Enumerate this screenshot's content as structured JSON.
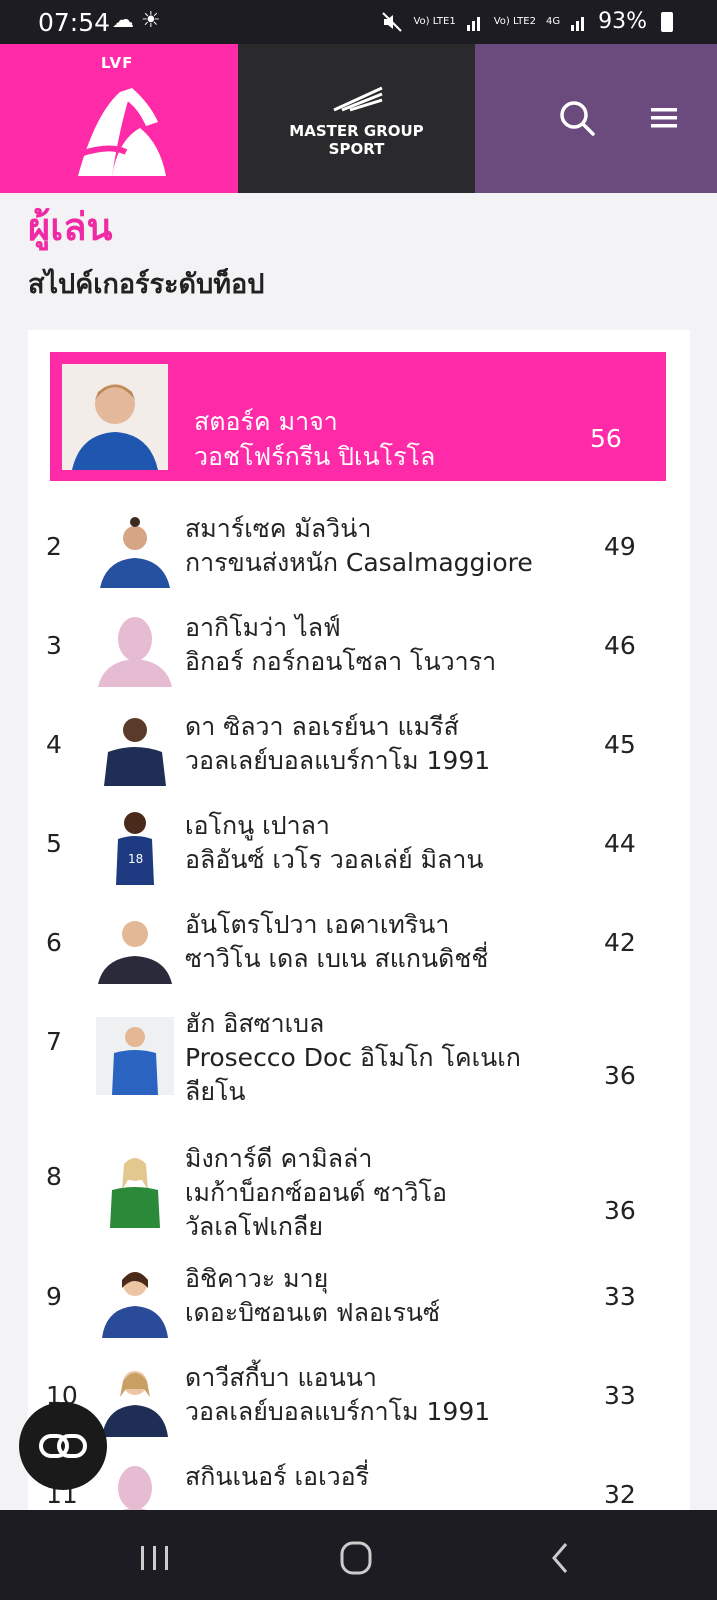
{
  "status_bar": {
    "time": "07:54",
    "weather": "☁ ☀",
    "lte1": "Vo) LTE1",
    "lte2": "Vo) LTE2",
    "network": "4G",
    "battery": "93%"
  },
  "header": {
    "logo_text": "LVF",
    "sponsor_line1": "MASTER GROUP",
    "sponsor_line2": "SPORT"
  },
  "page": {
    "title": "ผู้เล่น",
    "subtitle": "สไปค์เกอร์ระดับท็อป"
  },
  "leader": {
    "name": "สตอร์ค มาจา",
    "team": "วอชโฟร์กรีน ปิเนโรโล",
    "value": "56"
  },
  "players": [
    {
      "rank": "2",
      "name": "สมาร์เซค มัลวิน่า",
      "team": "การขนส่งหนัก Casalmaggiore",
      "value": "49"
    },
    {
      "rank": "3",
      "name": "อากิโมว่า ไลฟ์",
      "team": "อิกอร์ กอร์กอนโซลา โนวารา",
      "value": "46"
    },
    {
      "rank": "4",
      "name": "ดา ซิลวา ลอเรย์นา แมรีส์",
      "team": "วอลเลย์บอลแบร์กาโม 1991",
      "value": "45"
    },
    {
      "rank": "5",
      "name": "เอโกนู เปาลา",
      "team": "อลิอันซ์ เวโร วอลเล่ย์ มิลาน",
      "value": "44"
    },
    {
      "rank": "6",
      "name": "อันโตรโปวา เอคาเทรินา",
      "team": "ซาวิโน เดล เบเน สแกนดิชชี่",
      "value": "42"
    },
    {
      "rank": "7",
      "name": "ฮัก อิสซาเบล",
      "team": "Prosecco Doc อิโมโก โคเนเกลียโน",
      "value": "36"
    },
    {
      "rank": "8",
      "name": "มิงการ์ดี คามิลล่า",
      "team": "เมก้าบ็อกซ์ออนด์ ซาวิโอ วัลเลโฟเกลีย",
      "value": "36"
    },
    {
      "rank": "9",
      "name": "อิชิคาวะ มายุ",
      "team": "เดอะบิซอนเต ฟลอเรนซ์",
      "value": "33"
    },
    {
      "rank": "10",
      "name": "ดาวีสกี้บา แอนนา",
      "team": "วอลเลย์บอลแบร์กาโม 1991",
      "value": "33"
    },
    {
      "rank": "11",
      "name": "สกินเนอร์ เอเวอรี่",
      "team": "",
      "value": "32"
    }
  ],
  "colors": {
    "brand_pink": "#ff2aa8",
    "title_pink": "#f02aa4",
    "purple": "#6b4a7e",
    "dark": "#2a2a2c"
  },
  "icons": {
    "search": "search-icon",
    "menu": "hamburger-menu-icon",
    "fab": "link-icon"
  }
}
